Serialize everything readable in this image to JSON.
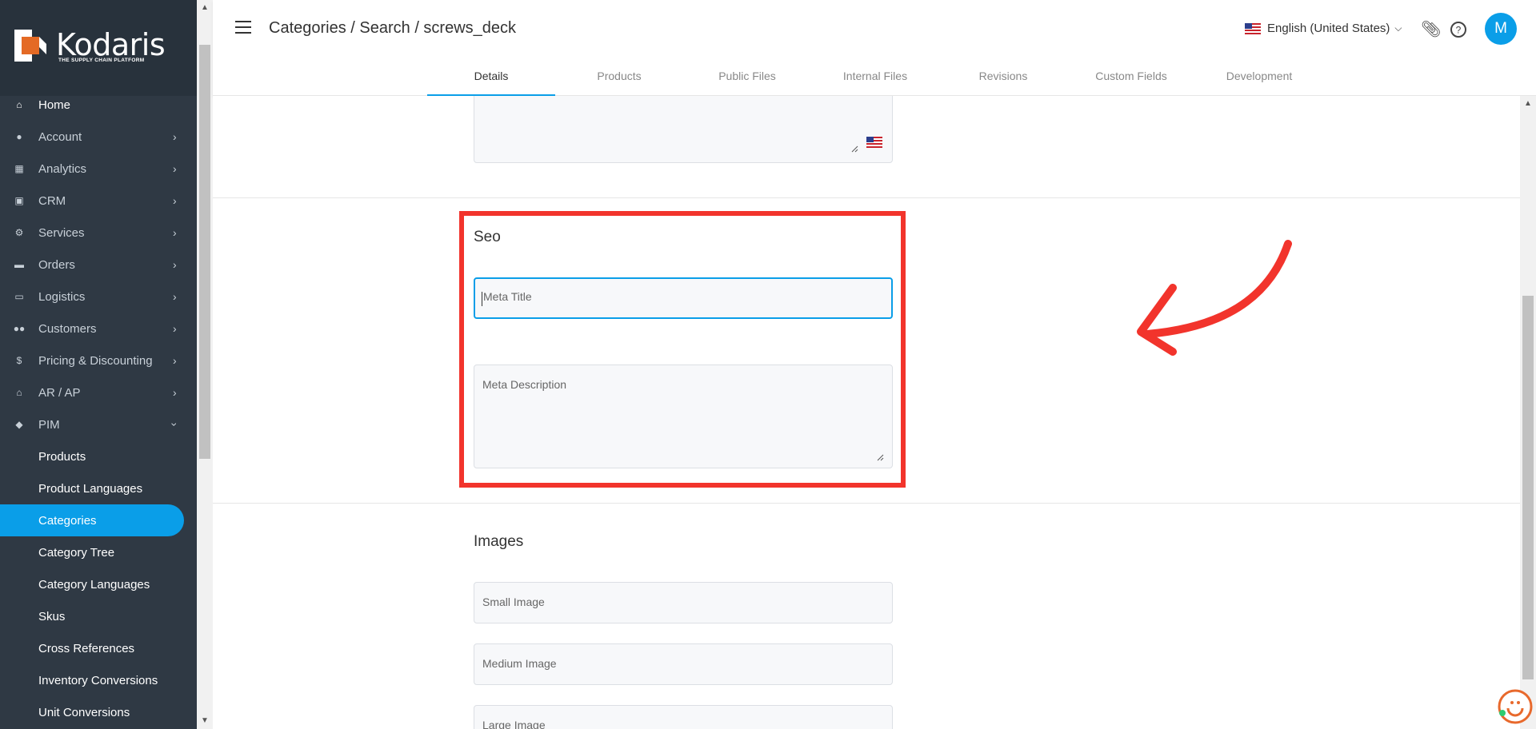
{
  "app": {
    "logo_text": "Kodaris",
    "logo_tagline": "THE SUPPLY CHAIN PLATFORM"
  },
  "sidebar": {
    "items": [
      {
        "label": "Home",
        "icon": "home-icon",
        "chevron": false
      },
      {
        "label": "Account",
        "icon": "person-icon",
        "chevron": true
      },
      {
        "label": "Analytics",
        "icon": "chart-icon",
        "chevron": true
      },
      {
        "label": "CRM",
        "icon": "contact-card-icon",
        "chevron": true
      },
      {
        "label": "Services",
        "icon": "gears-icon",
        "chevron": true
      },
      {
        "label": "Orders",
        "icon": "truck-icon",
        "chevron": true
      },
      {
        "label": "Logistics",
        "icon": "shipping-icon",
        "chevron": true
      },
      {
        "label": "Customers",
        "icon": "group-icon",
        "chevron": true
      },
      {
        "label": "Pricing & Discounting",
        "icon": "dollar-icon",
        "chevron": true
      },
      {
        "label": "AR / AP",
        "icon": "bank-icon",
        "chevron": true
      },
      {
        "label": "PIM",
        "icon": "tag-icon",
        "chevron": "open"
      }
    ],
    "pim_subitems": [
      {
        "label": "Products",
        "active": false
      },
      {
        "label": "Product Languages",
        "active": false
      },
      {
        "label": "Categories",
        "active": true
      },
      {
        "label": "Category Tree",
        "active": false
      },
      {
        "label": "Category Languages",
        "active": false
      },
      {
        "label": "Skus",
        "active": false
      },
      {
        "label": "Cross References",
        "active": false
      },
      {
        "label": "Inventory Conversions",
        "active": false
      },
      {
        "label": "Unit Conversions",
        "active": false
      }
    ]
  },
  "header": {
    "breadcrumb": "Categories / Search / screws_deck",
    "language": "English (United States)",
    "avatar_initial": "M",
    "tabs": [
      {
        "label": "Details",
        "active": true
      },
      {
        "label": "Products",
        "active": false
      },
      {
        "label": "Public Files",
        "active": false
      },
      {
        "label": "Internal Files",
        "active": false
      },
      {
        "label": "Revisions",
        "active": false
      },
      {
        "label": "Custom Fields",
        "active": false
      },
      {
        "label": "Development",
        "active": false
      }
    ]
  },
  "seo": {
    "title": "Seo",
    "meta_title_placeholder": "Meta Title",
    "meta_description_placeholder": "Meta Description"
  },
  "images": {
    "title": "Images",
    "small_image_placeholder": "Small Image",
    "medium_image_placeholder": "Medium Image",
    "large_image_placeholder": "Large Image"
  },
  "colors": {
    "accent": "#0a9ee8",
    "sidebar_bg": "#2f3944",
    "highlight": "#f2342c"
  }
}
